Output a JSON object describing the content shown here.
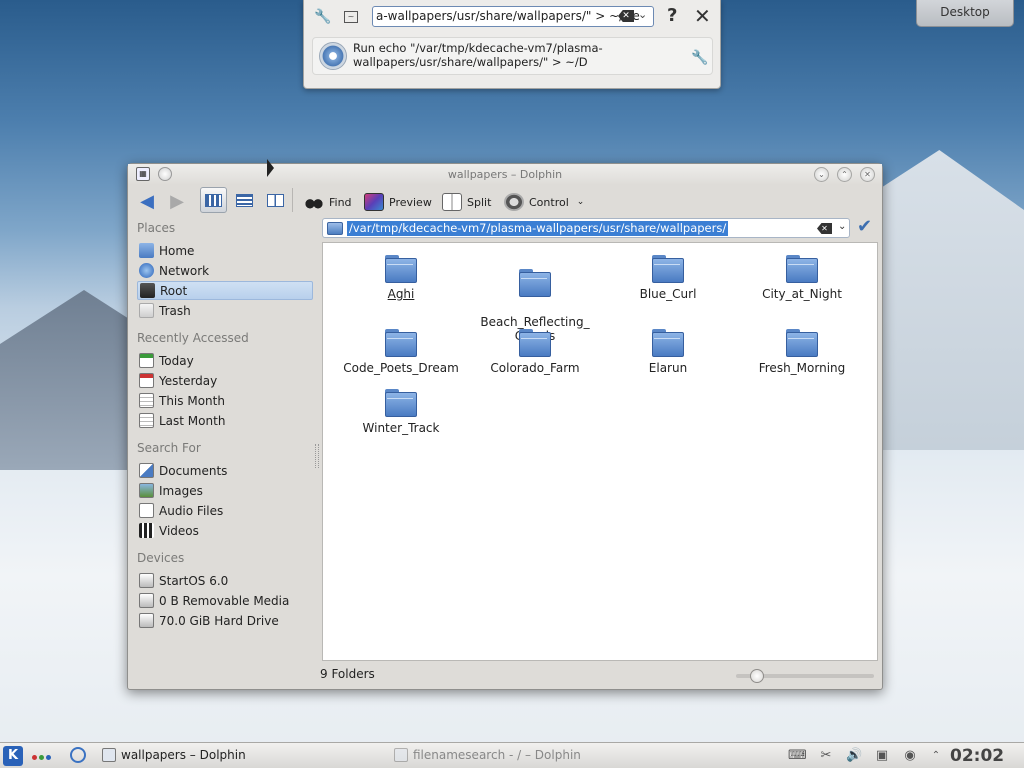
{
  "desktop_button": {
    "label": "Desktop"
  },
  "krunner": {
    "query": "a-wallpapers/usr/share/wallpapers/\" > ~/De",
    "result": "Run echo \"/var/tmp/kdecache-vm7/plasma-wallpapers/usr/share/wallpapers/\" > ~/D",
    "help_glyph": "?",
    "close_glyph": "✕"
  },
  "dolphin": {
    "title": "wallpapers – Dolphin",
    "toolbar": {
      "find": "Find",
      "preview": "Preview",
      "split": "Split",
      "control": "Control"
    },
    "places": {
      "sections": [
        "Places",
        "Recently Accessed",
        "Search For",
        "Devices"
      ],
      "places_items": [
        "Home",
        "Network",
        "Root",
        "Trash"
      ],
      "recent_items": [
        "Today",
        "Yesterday",
        "This Month",
        "Last Month"
      ],
      "search_items": [
        "Documents",
        "Images",
        "Audio Files",
        "Videos"
      ],
      "device_items": [
        "StartOS 6.0",
        "0 B Removable Media",
        "70.0 GiB Hard Drive"
      ],
      "selected": "Root"
    },
    "address": "/var/tmp/kdecache-vm7/plasma-wallpapers/usr/share/wallpapers/",
    "folders": [
      {
        "name": "Aghi"
      },
      {
        "name": "Beach_Reflecting_\nClouds"
      },
      {
        "name": "Blue_Curl"
      },
      {
        "name": "City_at_Night"
      },
      {
        "name": "Code_Poets_Dream"
      },
      {
        "name": "Colorado_Farm"
      },
      {
        "name": "Elarun"
      },
      {
        "name": "Fresh_Morning"
      },
      {
        "name": "Winter_Track"
      }
    ],
    "status": "9 Folders"
  },
  "taskbar": {
    "k_label": "K",
    "tasks": [
      "wallpapers – Dolphin",
      "filenamesearch - / – Dolphin"
    ],
    "clock": "02:02"
  },
  "colors": {
    "accent": "#3b7fd4",
    "selection": "#b8d0ec",
    "folder": "#4a7bc2"
  }
}
